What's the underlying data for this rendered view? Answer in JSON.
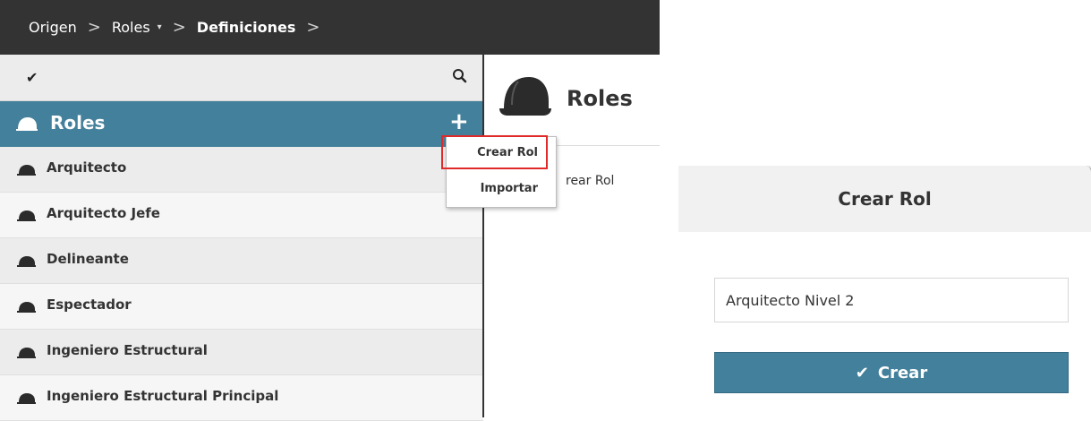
{
  "breadcrumb": {
    "items": [
      "Origen",
      "Roles",
      "Definiciones"
    ],
    "separator": ">",
    "dropdown_caret": "▾"
  },
  "sidebar": {
    "toolbar_check": "✔",
    "header_title": "Roles",
    "add_symbol": "+",
    "items": [
      {
        "label": "Arquitecto"
      },
      {
        "label": "Arquitecto Jefe"
      },
      {
        "label": "Delineante"
      },
      {
        "label": "Espectador"
      },
      {
        "label": "Ingeniero Estructural"
      },
      {
        "label": "Ingeniero Estructural Principal"
      }
    ]
  },
  "main": {
    "title": "Roles",
    "link_partial": "rear Rol"
  },
  "dropdown": {
    "create_label": "Crear Rol",
    "import_label": "Importar"
  },
  "dialog": {
    "title": "Crear Rol",
    "name_value": "Arquitecto Nivel 2",
    "submit_label": "Crear",
    "submit_icon": "✔"
  },
  "colors": {
    "accent": "#43809b",
    "breadcrumb_bg": "#333333",
    "highlight": "#e02a2a"
  },
  "icons": {
    "hat": "hard-hat-icon",
    "search": "search-icon",
    "check": "check-icon",
    "plus": "plus-icon"
  }
}
